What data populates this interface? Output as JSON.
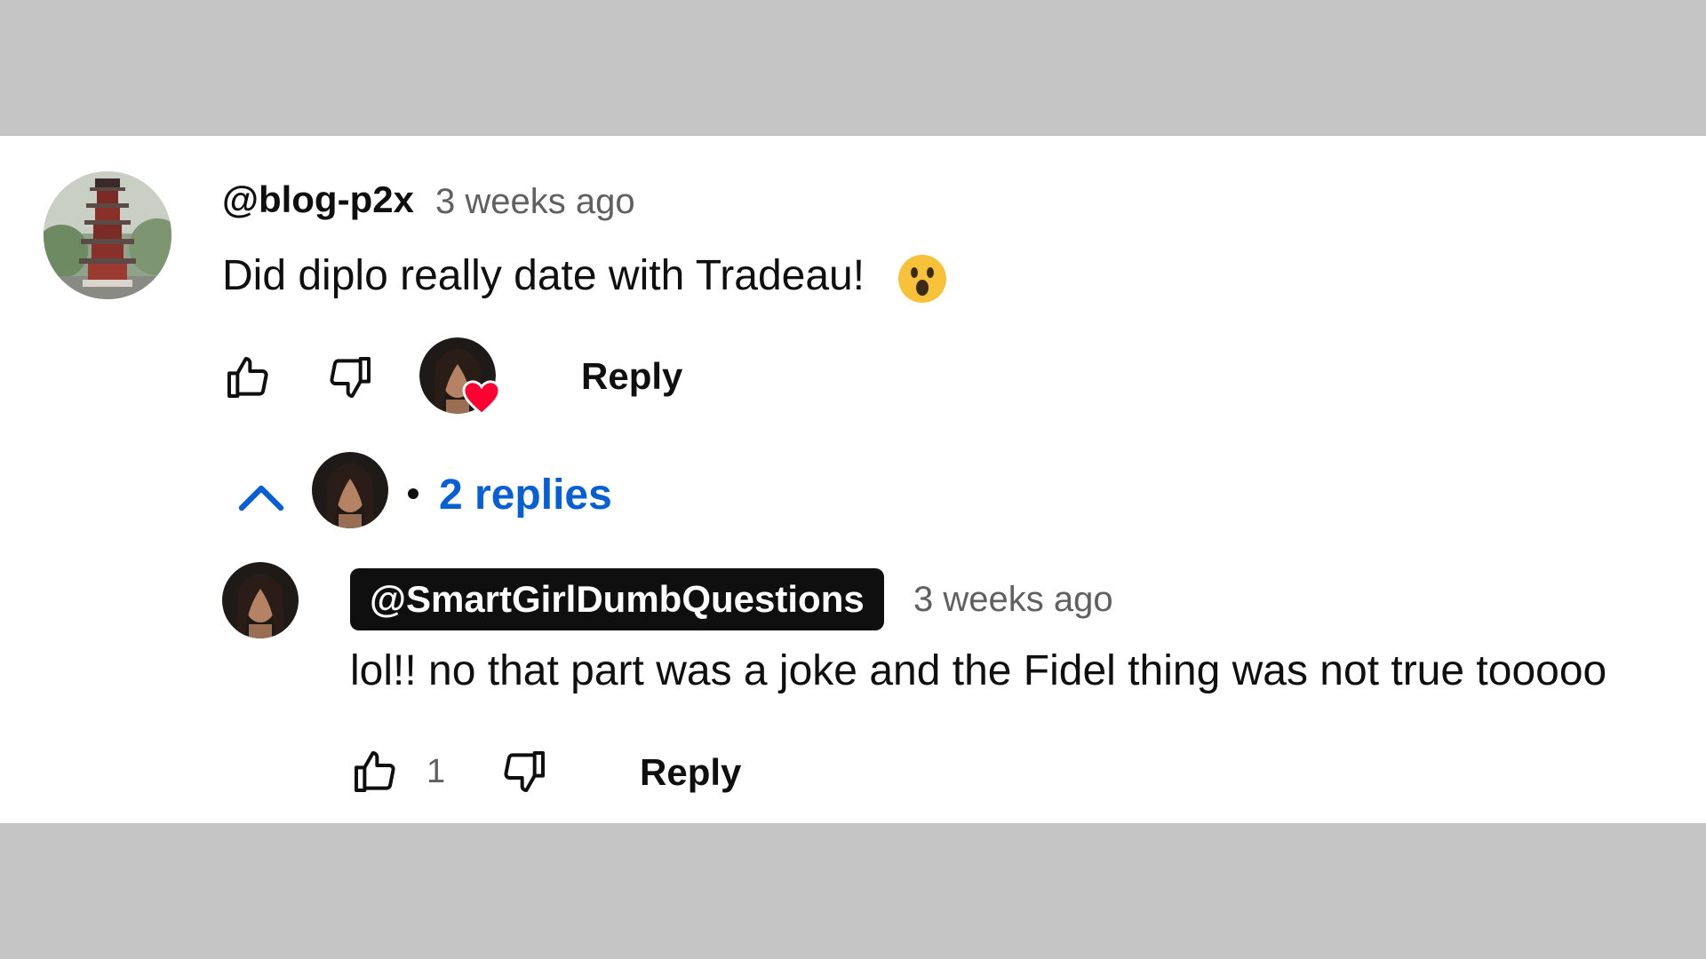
{
  "comment": {
    "author": "@blog-p2x",
    "time": "3 weeks ago",
    "text": "Did diplo really date with Tradeau!",
    "emoji": "surprised-face",
    "reply_label": "Reply"
  },
  "replies_toggle": {
    "label": "2 replies",
    "accent": "#065fd4"
  },
  "reply": {
    "author": "@SmartGirlDumbQuestions",
    "time": "3 weeks ago",
    "text": "lol!! no that part was a joke and the Fidel thing was not true tooooo",
    "like_count": "1",
    "reply_label": "Reply"
  },
  "colors": {
    "background": "#c5c5c5",
    "panel": "#ffffff",
    "heart": "#ff0033",
    "owner_chip": "#0f0f0f"
  }
}
